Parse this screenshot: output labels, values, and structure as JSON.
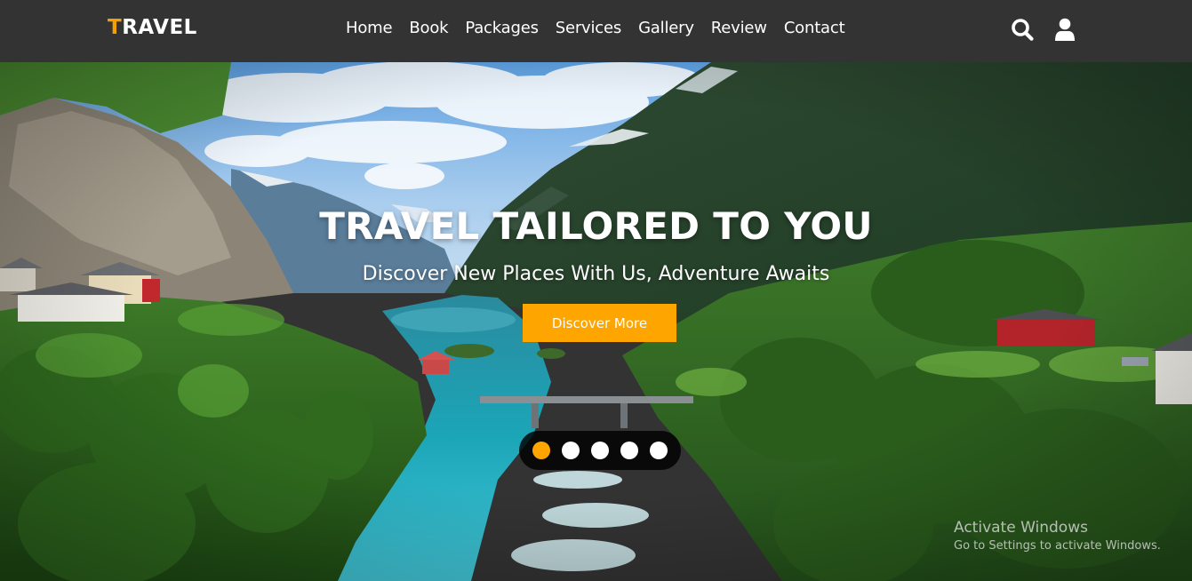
{
  "brand": {
    "first_letter": "T",
    "rest": "RAVEL",
    "accent_color": "#f5a000"
  },
  "nav": {
    "links": [
      "Home",
      "Book",
      "Packages",
      "Services",
      "Gallery",
      "Review",
      "Contact"
    ],
    "icons": [
      "search-icon",
      "user-icon"
    ]
  },
  "hero": {
    "title": "TRAVEL TAILORED TO YOU",
    "subtitle": "Discover New Places With Us, Adventure Awaits",
    "button_label": "Discover More",
    "button_color": "#ffa500",
    "slides": {
      "count": 5,
      "active": 1
    }
  },
  "os_overlay": {
    "title": "Activate Windows",
    "subtitle": "Go to Settings to activate Windows."
  }
}
